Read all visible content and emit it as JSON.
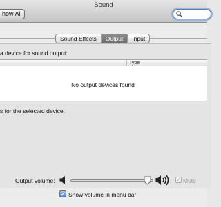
{
  "window": {
    "title": "Sound"
  },
  "toolbar": {
    "show_all_label": "how All",
    "search_value": "",
    "search_icon": "magnifier-icon"
  },
  "tabs": [
    {
      "label": "Sound Effects",
      "selected": false
    },
    {
      "label": "Output",
      "selected": true
    },
    {
      "label": "Input",
      "selected": false
    }
  ],
  "output": {
    "device_heading": "a device for sound output:",
    "table": {
      "columns": [
        "",
        "Type"
      ],
      "empty_message": "No output devices found"
    },
    "settings_heading": "s for the selected device:",
    "volume": {
      "label": "Output volume:",
      "level_fraction": 0.9,
      "low_icon": "speaker-low-icon",
      "high_icon": "speaker-high-icon"
    },
    "mute": {
      "label": "Mute",
      "checked": false,
      "enabled": false
    },
    "show_in_menu_bar": {
      "label": "Show volume in menu bar",
      "checked": true
    }
  },
  "colors": {
    "accent": "#3f86d8",
    "selected_tab": "#7a7a7a"
  }
}
